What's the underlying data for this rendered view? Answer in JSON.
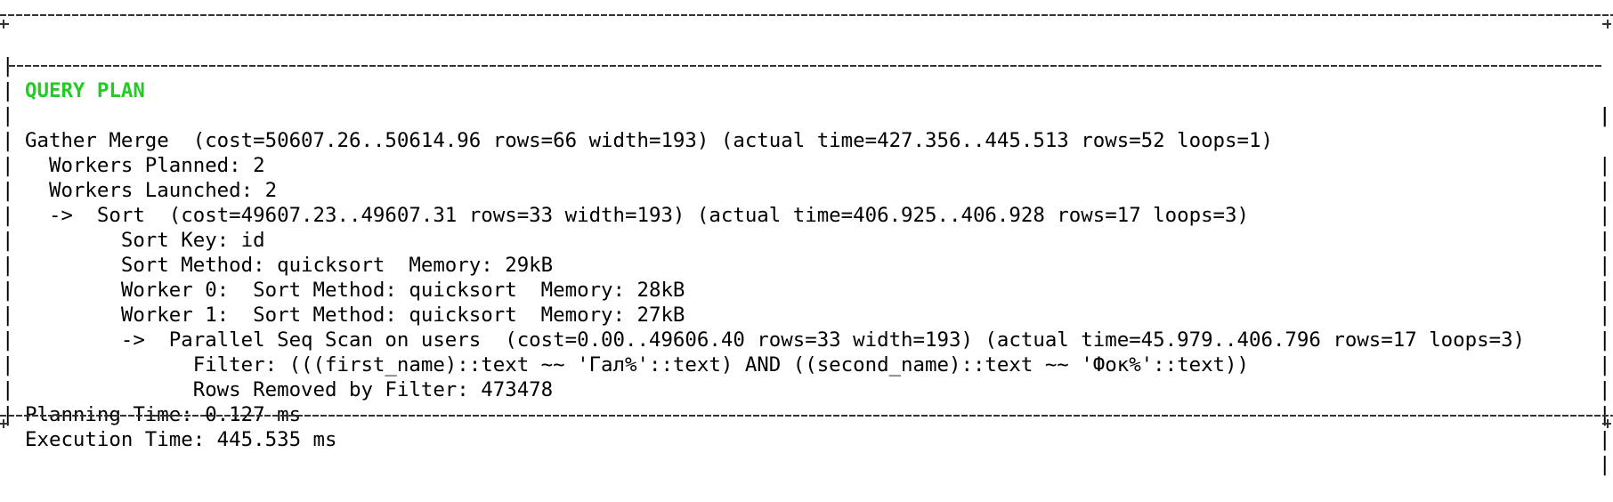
{
  "terminal": {
    "top_fragment": "",
    "header": "QUERY PLAN",
    "lines": [
      "Gather Merge  (cost=50607.26..50614.96 rows=66 width=193) (actual time=427.356..445.513 rows=52 loops=1)",
      "  Workers Planned: 2",
      "  Workers Launched: 2",
      "  ->  Sort  (cost=49607.23..49607.31 rows=33 width=193) (actual time=406.925..406.928 rows=17 loops=3)",
      "        Sort Key: id",
      "        Sort Method: quicksort  Memory: 29kB",
      "        Worker 0:  Sort Method: quicksort  Memory: 28kB",
      "        Worker 1:  Sort Method: quicksort  Memory: 27kB",
      "        ->  Parallel Seq Scan on users  (cost=0.00..49606.40 rows=33 width=193) (actual time=45.979..406.796 rows=17 loops=3)",
      "              Filter: (((first_name)::text ~~ 'Гал%'::text) AND ((second_name)::text ~~ 'Фок%'::text))",
      "              Rows Removed by Filter: 473478",
      "Planning Time: 0.127 ms",
      "Execution Time: 445.535 ms"
    ]
  },
  "colors": {
    "header": "#22cc22",
    "text": "#000000",
    "background": "#ffffff"
  }
}
